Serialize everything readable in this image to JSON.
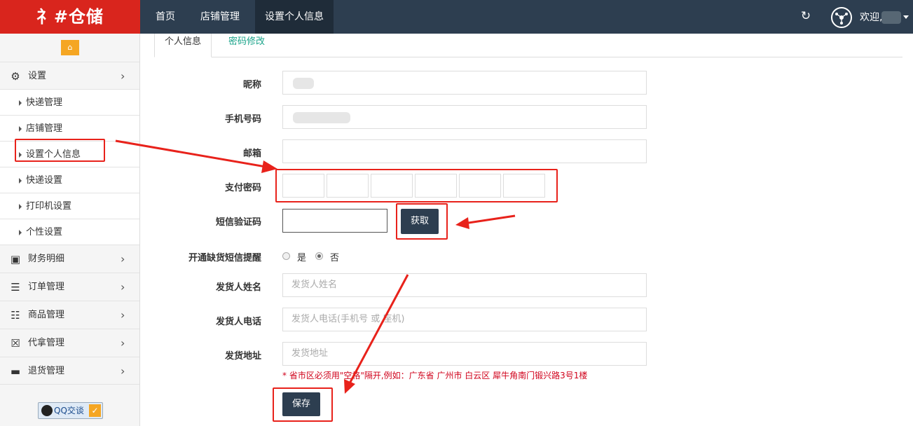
{
  "header": {
    "logo": "礻#仓储",
    "nav": [
      "首页",
      "店铺管理",
      "设置个人信息"
    ],
    "active_nav": "设置个人信息",
    "refresh_icon": "refresh-icon",
    "welcome": "欢迎,"
  },
  "sidebar": {
    "home_icon": "home-icon",
    "settings": {
      "label": "设置",
      "icon": "gears-icon"
    },
    "sub_items": [
      "快递管理",
      "店铺管理",
      "设置个人信息",
      "快递设置",
      "打印机设置",
      "个性设置"
    ],
    "menus": [
      {
        "label": "财务明细",
        "icon": "briefcase-icon"
      },
      {
        "label": "订单管理",
        "icon": "bars-icon"
      },
      {
        "label": "商品管理",
        "icon": "list-icon"
      },
      {
        "label": "代拿管理",
        "icon": "cart-icon"
      },
      {
        "label": "退货管理",
        "icon": "truck-icon"
      }
    ],
    "qq_label": "QQ交谈"
  },
  "tabs": {
    "active": "个人信息",
    "other": "密码修改"
  },
  "form": {
    "nickname_label": "昵称",
    "phone_label": "手机号码",
    "email_label": "邮箱",
    "paypw_label": "支付密码",
    "sms_label": "短信验证码",
    "get_code_button": "获取",
    "stock_sms_label": "开通缺货短信提醒",
    "radio_yes": "是",
    "radio_no": "否",
    "radio_selected": "否",
    "sender_name_label": "发货人姓名",
    "sender_name_placeholder": "发货人姓名",
    "sender_phone_label": "发货人电话",
    "sender_phone_placeholder": "发货人电话(手机号 或 座机)",
    "address_label": "发货地址",
    "address_placeholder": "发货地址",
    "address_hint": "* 省市区必须用\"空格\"隔开,例如：广东省 广州市 白云区 犀牛角南门锻兴路3号1楼",
    "save_button": "保存"
  },
  "colors": {
    "brand_red": "#d9251d",
    "topbar": "#2d3e50",
    "accent_green": "#1aa38a",
    "annotation_red": "#e8221b"
  }
}
